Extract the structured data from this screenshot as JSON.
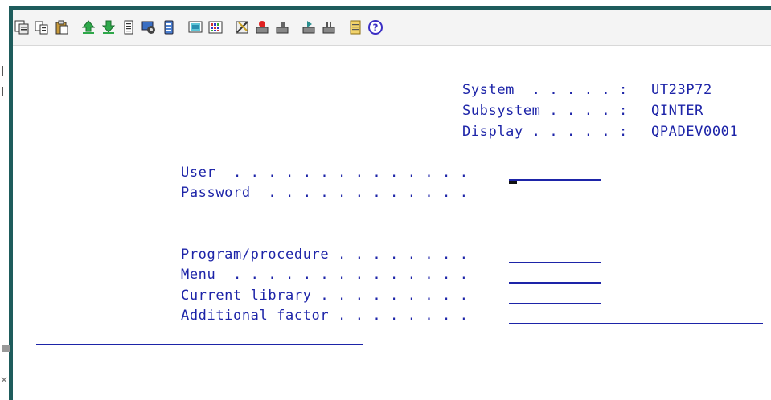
{
  "toolbar": {
    "buttons": [
      {
        "name": "copy-screen-icon"
      },
      {
        "name": "copy-icon"
      },
      {
        "name": "paste-icon"
      },
      {
        "name": "send-file-icon"
      },
      {
        "name": "receive-file-icon"
      },
      {
        "name": "print-icon"
      },
      {
        "name": "settings-icon"
      },
      {
        "name": "keypad-icon"
      },
      {
        "name": "display-icon"
      },
      {
        "name": "grid-icon"
      },
      {
        "name": "macro-icon"
      },
      {
        "name": "record-macro-icon"
      },
      {
        "name": "stop-macro-icon"
      },
      {
        "name": "play-macro-icon"
      },
      {
        "name": "pause-macro-icon"
      },
      {
        "name": "notes-icon"
      },
      {
        "name": "help-icon"
      }
    ]
  },
  "system_info": {
    "system_label": "System  . . . . . :",
    "system_value": "UT23P72",
    "subsystem_label": "Subsystem . . . . :",
    "subsystem_value": "QINTER",
    "display_label": "Display . . . . . :",
    "display_value": "QPADEV0001"
  },
  "signon": {
    "user_label": "User  . . . . . . . . . . . . . .",
    "password_label": "Password  . . . . . . . . . . . .",
    "program_label": "Program/procedure . . . . . . . .",
    "menu_label": "Menu  . . . . . . . . . . . . . .",
    "library_label": "Current library . . . . . . . . .",
    "factor_label": "Additional factor . . . . . . . ."
  },
  "colors": {
    "text": "#1d24a8",
    "frame": "#1e5c5c"
  }
}
